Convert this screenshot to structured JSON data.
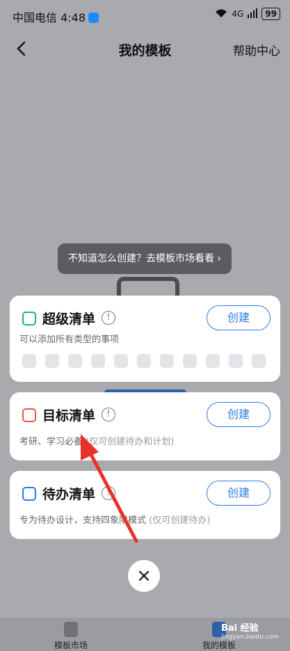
{
  "statusbar": {
    "carrier_time": "中国电信 4:48",
    "signal": "4G",
    "battery": "99"
  },
  "nav": {
    "title": "我的模板",
    "help": "帮助中心"
  },
  "tooltip": "不知道怎么创建？去模板市场看看 ›",
  "cards": [
    {
      "title": "超级清单",
      "desc": "可以添加所有类型的事项",
      "button": "创建",
      "icon_color": "#22b07d"
    },
    {
      "title": "目标清单",
      "desc": "考研、学习必备",
      "desc_note": "(仅可创建待办和计划)",
      "button": "创建",
      "icon_color": "#e8554e"
    },
    {
      "title": "待办清单",
      "desc": "专为待办设计，支持四象限模式",
      "desc_note": "(仅可创建待办)",
      "button": "创建",
      "icon_color": "#2d7be5"
    }
  ],
  "info_mark": "!",
  "close_label": "×",
  "bottom_nav": [
    {
      "label": "模板市场"
    },
    {
      "label": "我的模板"
    }
  ],
  "watermark": {
    "brand": "Bai 经验",
    "url": "jingyan.baidu.com"
  },
  "colors": {
    "accent": "#2d7be5",
    "overlay": "#a8aaad"
  }
}
